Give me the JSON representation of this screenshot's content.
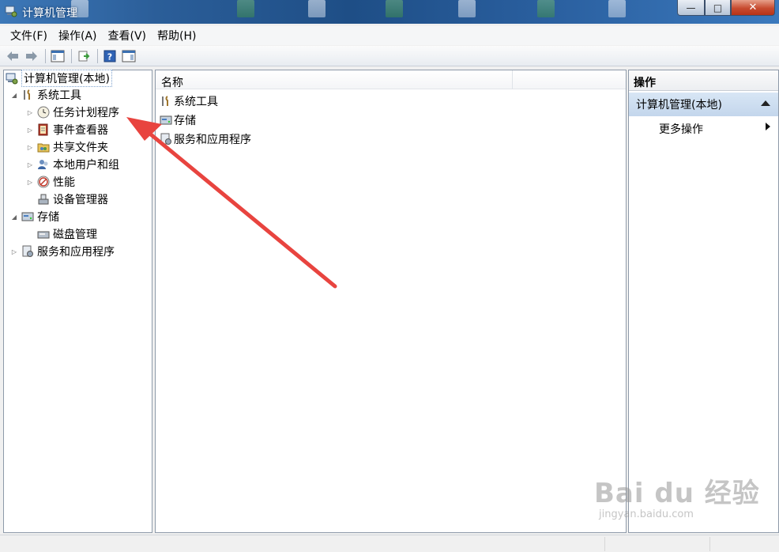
{
  "window": {
    "title": "计算机管理"
  },
  "menu": [
    "文件(F)",
    "操作(A)",
    "查看(V)",
    "帮助(H)"
  ],
  "tree": {
    "root": "计算机管理(本地)",
    "system_tools": "系统工具",
    "task_scheduler": "任务计划程序",
    "event_viewer": "事件查看器",
    "shared_folders": "共享文件夹",
    "local_users": "本地用户和组",
    "performance": "性能",
    "device_manager": "设备管理器",
    "storage": "存储",
    "disk_management": "磁盘管理",
    "services_apps": "服务和应用程序"
  },
  "center": {
    "column_name": "名称",
    "items": [
      "系统工具",
      "存储",
      "服务和应用程序"
    ]
  },
  "actions": {
    "header": "操作",
    "section": "计算机管理(本地)",
    "more": "更多操作"
  },
  "watermark": {
    "main": "Bai du 经验",
    "sub": "jingyan.baidu.com"
  },
  "colors": {
    "accent_arrow": "#e8443f",
    "selection": "#c3d6ec"
  }
}
